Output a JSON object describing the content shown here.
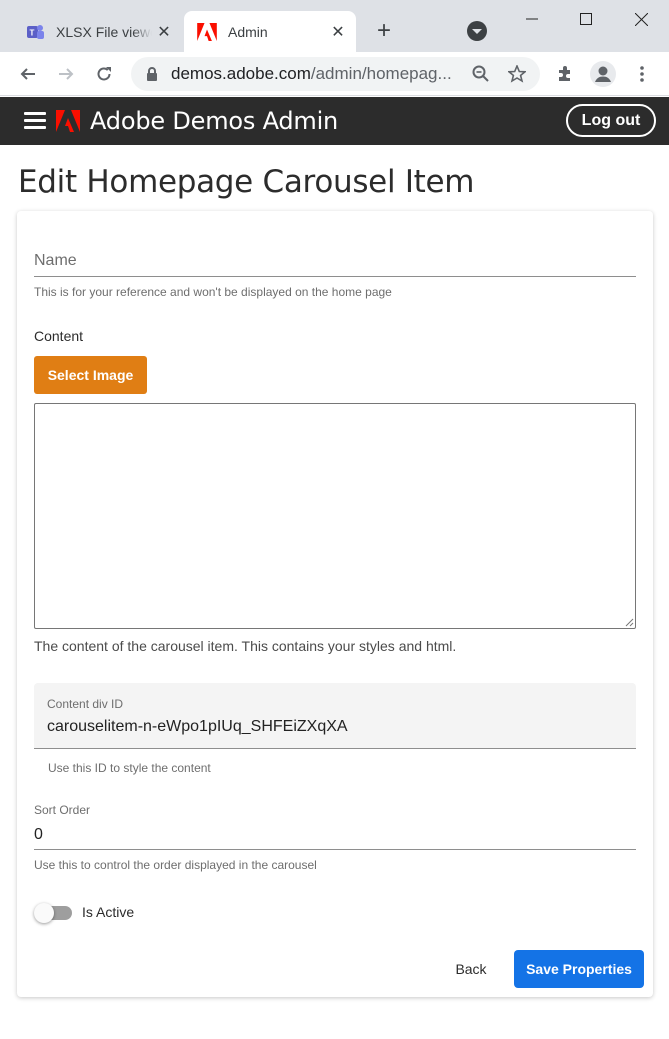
{
  "browser": {
    "tabs": [
      {
        "label": "XLSX File viewer",
        "icon": "teams-icon"
      },
      {
        "label": "Admin",
        "icon": "adobe-icon"
      }
    ],
    "new_tab": "+",
    "url_host": "demos.adobe.com",
    "url_path": "/admin/homepag..."
  },
  "header": {
    "title": "Adobe Demos Admin",
    "logout_label": "Log out"
  },
  "page": {
    "title": "Edit Homepage Carousel Item"
  },
  "form": {
    "name_placeholder": "Name",
    "name_helper": "This is for your reference and won't be displayed on the home page",
    "content_label": "Content",
    "select_image_label": "Select Image",
    "content_value": "",
    "content_helper": "The content of the carousel item. This contains your styles and html.",
    "content_div_label": "Content div ID",
    "content_div_value": "carouselitem-n-eWpo1pIUq_SHFEiZXqXA",
    "content_div_helper": "Use this ID to style the content",
    "sort_order_label": "Sort Order",
    "sort_order_value": "0",
    "sort_order_helper": "Use this to control the order displayed in the carousel",
    "is_active_label": "Is Active",
    "is_active": false
  },
  "actions": {
    "back_label": "Back",
    "save_label": "Save Properties"
  },
  "colors": {
    "accent_orange": "#e07e14",
    "primary_blue": "#1473e6",
    "header_bg": "#2c2c2c",
    "adobe_red": "#fa0f00"
  }
}
